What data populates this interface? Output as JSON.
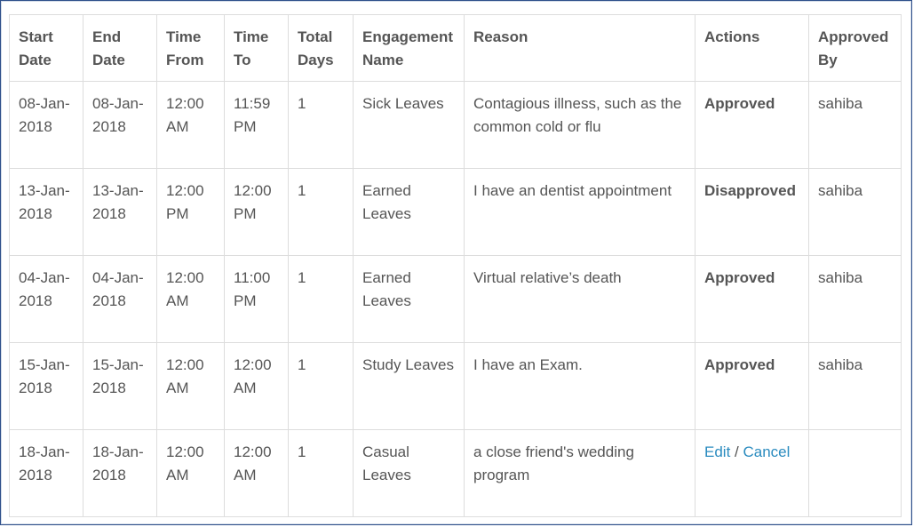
{
  "table": {
    "headers": [
      "Start Date",
      "End Date",
      "Time From",
      "Time To",
      "Total Days",
      "Engagement Name",
      "Reason",
      "Actions",
      "Approved By"
    ],
    "rows": [
      {
        "start_date": "08-Jan-2018",
        "end_date": "08-Jan-2018",
        "time_from": "12:00 AM",
        "time_to": "11:59 PM",
        "total_days": "1",
        "engagement": "Sick Leaves",
        "reason": "Contagious illness, such as the common cold or flu",
        "action": "Approved",
        "approved_by": "sahiba"
      },
      {
        "start_date": "13-Jan-2018",
        "end_date": "13-Jan-2018",
        "time_from": "12:00 PM",
        "time_to": "12:00 PM",
        "total_days": "1",
        "engagement": "Earned Leaves",
        "reason": "I have an dentist appointment",
        "action": "Disapproved",
        "approved_by": "sahiba"
      },
      {
        "start_date": "04-Jan-2018",
        "end_date": "04-Jan-2018",
        "time_from": "12:00 AM",
        "time_to": "11:00 PM",
        "total_days": "1",
        "engagement": "Earned Leaves",
        "reason": "Virtual relative’s death",
        "action": "Approved",
        "approved_by": "sahiba"
      },
      {
        "start_date": "15-Jan-2018",
        "end_date": "15-Jan-2018",
        "time_from": "12:00 AM",
        "time_to": "12:00 AM",
        "total_days": "1",
        "engagement": "Study Leaves",
        "reason": "I have an Exam.",
        "action": "Approved",
        "approved_by": "sahiba"
      },
      {
        "start_date": "18-Jan-2018",
        "end_date": "18-Jan-2018",
        "time_from": "12:00 AM",
        "time_to": "12:00 AM",
        "total_days": "1",
        "engagement": "Casual Leaves",
        "reason": "a close friend's wedding program",
        "edit_label": "Edit",
        "separator": "/",
        "cancel_label": "Cancel",
        "approved_by": ""
      }
    ]
  },
  "colors": {
    "link": "#2a8bbf",
    "border": "#dddddd",
    "text": "#555555",
    "frame": "#2e4f8a"
  }
}
